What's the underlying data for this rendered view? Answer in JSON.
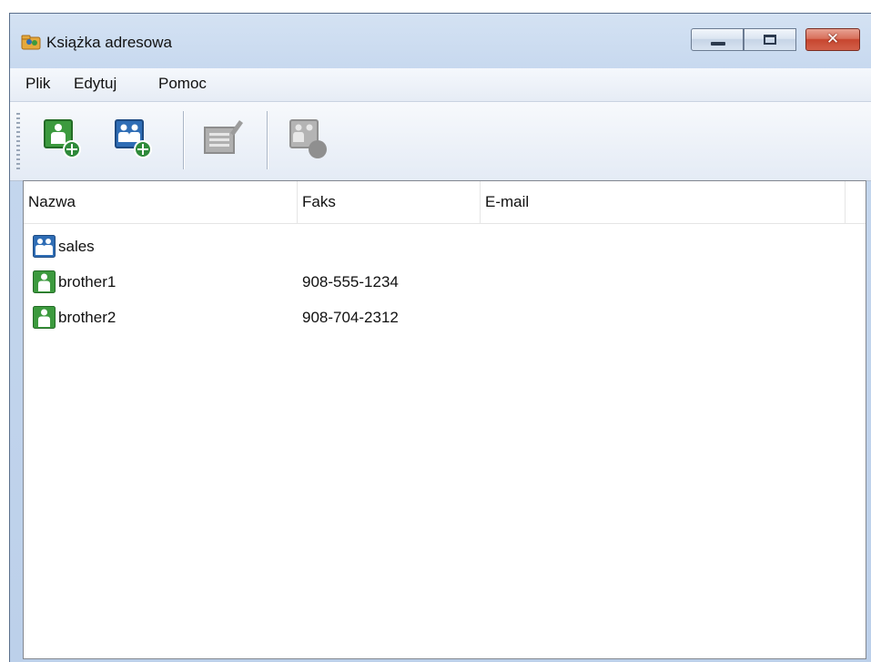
{
  "window": {
    "title": "Książka adresowa"
  },
  "menu": [
    {
      "label": "Plik"
    },
    {
      "label": "Edytuj"
    },
    {
      "label": "Pomoc"
    }
  ],
  "toolbar": {
    "buttons": [
      {
        "icon": "add-member-icon",
        "enabled": true
      },
      {
        "icon": "add-group-icon",
        "enabled": true
      },
      {
        "icon": "edit-icon",
        "enabled": false
      },
      {
        "icon": "delete-icon",
        "enabled": false
      }
    ]
  },
  "table": {
    "columns": [
      "Nazwa",
      "Faks",
      "E-mail"
    ],
    "rows": [
      {
        "type": "group",
        "icon": "group-icon",
        "name": "sales",
        "fax": "",
        "email": ""
      },
      {
        "type": "member",
        "icon": "person-icon",
        "name": "brother1",
        "fax": "908-555-1234",
        "email": ""
      },
      {
        "type": "member",
        "icon": "person-icon",
        "name": "brother2",
        "fax": "908-704-2312",
        "email": ""
      }
    ]
  },
  "colors": {
    "person_icon_green": "#3c9a3e",
    "group_icon_blue": "#2f6db5",
    "titlebar": "#c5d7ee",
    "close_button": "#c7462f"
  }
}
